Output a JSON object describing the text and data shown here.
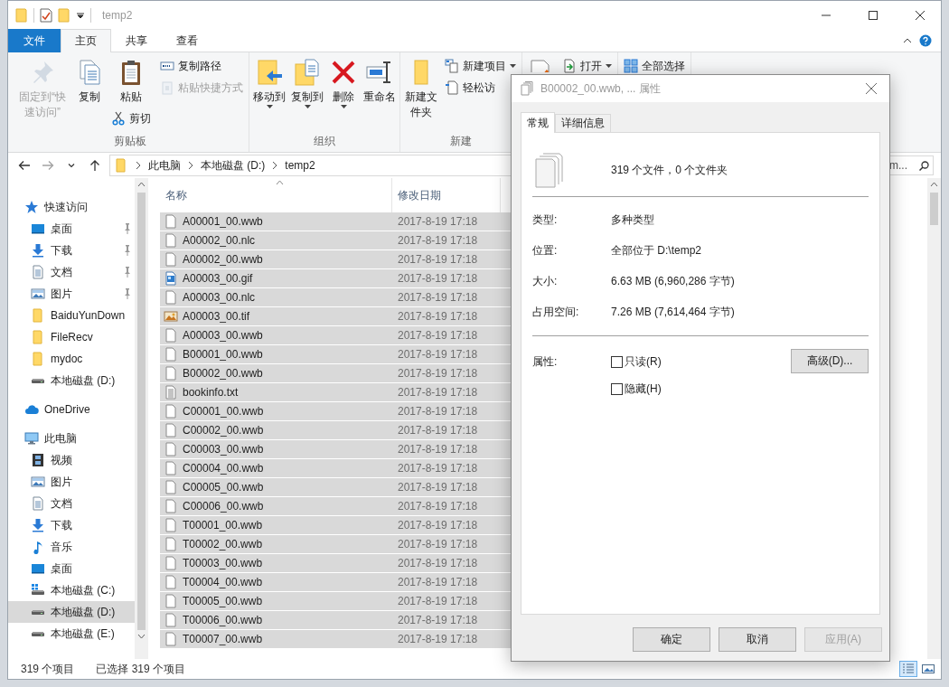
{
  "window": {
    "title": "temp2"
  },
  "ribbon": {
    "tabs": [
      {
        "label": "文件",
        "kind": "file_menu",
        "selected": false
      },
      {
        "label": "主页",
        "kind": "tab",
        "selected": true
      },
      {
        "label": "共享",
        "kind": "tab",
        "selected": false
      },
      {
        "label": "查看",
        "kind": "tab",
        "selected": false
      }
    ],
    "groups": [
      {
        "label": "剪贴板",
        "columns": [
          [
            {
              "kind": "pin",
              "label": "固定到“快速访问”",
              "disabled": true,
              "dropdown": false
            }
          ],
          [
            {
              "kind": "copy",
              "label": "复制",
              "disabled": false,
              "dropdown": false
            }
          ],
          [
            {
              "kind": "paste",
              "label": "粘贴",
              "disabled": false,
              "dropdown": false
            },
            {
              "kind": "cut",
              "label": "剪切",
              "disabled": false,
              "dropdown": false
            }
          ],
          [
            {
              "kind": "copy_path",
              "label": "复制路径",
              "disabled": false,
              "dropdown": false
            },
            {
              "kind": "paste_shortcut",
              "label": "粘贴快捷方式",
              "disabled": true,
              "dropdown": false
            }
          ]
        ]
      },
      {
        "label": "组织",
        "columns": [
          [
            {
              "kind": "move_to",
              "label": "移动到",
              "disabled": false,
              "dropdown": true
            }
          ],
          [
            {
              "kind": "copy_to",
              "label": "复制到",
              "disabled": false,
              "dropdown": true
            }
          ],
          [
            {
              "kind": "delete",
              "label": "删除",
              "disabled": false,
              "dropdown": true
            }
          ],
          [
            {
              "kind": "rename",
              "label": "重命名",
              "disabled": false,
              "dropdown": false
            }
          ]
        ]
      },
      {
        "label": "新建",
        "columns": [
          [
            {
              "kind": "new_folder",
              "label": "新建文件夹",
              "disabled": false,
              "dropdown": false
            }
          ],
          [
            {
              "kind": "new_item",
              "label": "新建项目",
              "disabled": false,
              "dropdown": true
            },
            {
              "kind": "easy_access",
              "label": "轻松访",
              "disabled": false,
              "dropdown": false
            }
          ]
        ]
      },
      {
        "columns": [
          [
            {
              "kind": "properties",
              "disabled": false,
              "dropdown": false
            }
          ],
          [
            {
              "kind": "open",
              "label": "打开",
              "disabled": false,
              "dropdown": true
            }
          ]
        ]
      },
      {
        "columns": [
          [
            {
              "kind": "select_all",
              "label": "全部选择",
              "disabled": false,
              "dropdown": false
            }
          ]
        ]
      }
    ]
  },
  "address": {
    "nav_buttons": [
      {
        "kind": "back",
        "disabled": false
      },
      {
        "kind": "forward",
        "disabled": true
      },
      {
        "kind": "recent",
        "disabled": false
      },
      {
        "kind": "up",
        "disabled": false
      }
    ],
    "segments": [
      "此电脑",
      "本地磁盘 (D:)",
      "temp2"
    ],
    "search": "m..."
  },
  "sidebar": {
    "items": [
      {
        "label": "快速访问",
        "kind": "quick_access",
        "selected": false,
        "children": [
          {
            "label": "桌面",
            "kind": "desktop",
            "pinned": true,
            "selected": false
          },
          {
            "label": "下载",
            "kind": "downloads",
            "pinned": true,
            "selected": false
          },
          {
            "label": "文档",
            "kind": "documents",
            "pinned": true,
            "selected": false
          },
          {
            "label": "图片",
            "kind": "pictures",
            "pinned": true,
            "selected": false
          },
          {
            "label": "BaiduYunDown",
            "kind": "folder",
            "pinned": false,
            "selected": false
          },
          {
            "label": "FileRecv",
            "kind": "folder",
            "pinned": false,
            "selected": false
          },
          {
            "label": "mydoc",
            "kind": "folder",
            "pinned": false,
            "selected": false
          },
          {
            "label": "本地磁盘 (D:)",
            "kind": "drive",
            "pinned": false,
            "selected": false
          }
        ]
      },
      {
        "label": "OneDrive",
        "kind": "onedrive",
        "selected": false
      },
      {
        "label": "此电脑",
        "kind": "this_pc",
        "selected": false,
        "children": [
          {
            "label": "视频",
            "kind": "videos",
            "pinned": false,
            "selected": false
          },
          {
            "label": "图片",
            "kind": "pictures",
            "pinned": false,
            "selected": false
          },
          {
            "label": "文档",
            "kind": "documents",
            "pinned": false,
            "selected": false
          },
          {
            "label": "下载",
            "kind": "downloads",
            "pinned": false,
            "selected": false
          },
          {
            "label": "音乐",
            "kind": "music",
            "pinned": false,
            "selected": false
          },
          {
            "label": "桌面",
            "kind": "desktop",
            "pinned": false,
            "selected": false
          },
          {
            "label": "本地磁盘 (C:)",
            "kind": "system_drive",
            "pinned": false,
            "selected": false
          },
          {
            "label": "本地磁盘 (D:)",
            "kind": "drive",
            "pinned": false,
            "selected": true
          },
          {
            "label": "本地磁盘 (E:)",
            "kind": "drive",
            "pinned": false,
            "selected": false
          }
        ]
      }
    ]
  },
  "file_list": {
    "columns": [
      {
        "label": "名称",
        "sorted": true
      },
      {
        "label": "修改日期",
        "sorted": false
      }
    ],
    "rows": [
      {
        "name": "A00001_00.wwb",
        "kind": "blank",
        "modified": "2017-8-19 17:18",
        "selected": true
      },
      {
        "name": "A00002_00.nlc",
        "kind": "blank",
        "modified": "2017-8-19 17:18",
        "selected": true
      },
      {
        "name": "A00002_00.wwb",
        "kind": "blank",
        "modified": "2017-8-19 17:18",
        "selected": true
      },
      {
        "name": "A00003_00.gif",
        "kind": "gif",
        "modified": "2017-8-19 17:18",
        "selected": true
      },
      {
        "name": "A00003_00.nlc",
        "kind": "blank",
        "modified": "2017-8-19 17:18",
        "selected": true
      },
      {
        "name": "A00003_00.tif",
        "kind": "tif",
        "modified": "2017-8-19 17:18",
        "selected": true
      },
      {
        "name": "A00003_00.wwb",
        "kind": "blank",
        "modified": "2017-8-19 17:18",
        "selected": true
      },
      {
        "name": "B00001_00.wwb",
        "kind": "blank",
        "modified": "2017-8-19 17:18",
        "selected": true
      },
      {
        "name": "B00002_00.wwb",
        "kind": "blank",
        "modified": "2017-8-19 17:18",
        "selected": true
      },
      {
        "name": "bookinfo.txt",
        "kind": "text",
        "modified": "2017-8-19 17:18",
        "selected": true
      },
      {
        "name": "C00001_00.wwb",
        "kind": "blank",
        "modified": "2017-8-19 17:18",
        "selected": true
      },
      {
        "name": "C00002_00.wwb",
        "kind": "blank",
        "modified": "2017-8-19 17:18",
        "selected": true
      },
      {
        "name": "C00003_00.wwb",
        "kind": "blank",
        "modified": "2017-8-19 17:18",
        "selected": true
      },
      {
        "name": "C00004_00.wwb",
        "kind": "blank",
        "modified": "2017-8-19 17:18",
        "selected": true
      },
      {
        "name": "C00005_00.wwb",
        "kind": "blank",
        "modified": "2017-8-19 17:18",
        "selected": true
      },
      {
        "name": "C00006_00.wwb",
        "kind": "blank",
        "modified": "2017-8-19 17:18",
        "selected": true
      },
      {
        "name": "T00001_00.wwb",
        "kind": "blank",
        "modified": "2017-8-19 17:18",
        "selected": true
      },
      {
        "name": "T00002_00.wwb",
        "kind": "blank",
        "modified": "2017-8-19 17:18",
        "selected": true
      },
      {
        "name": "T00003_00.wwb",
        "kind": "blank",
        "modified": "2017-8-19 17:18",
        "selected": true
      },
      {
        "name": "T00004_00.wwb",
        "kind": "blank",
        "modified": "2017-8-19 17:18",
        "selected": true
      },
      {
        "name": "T00005_00.wwb",
        "kind": "blank",
        "modified": "2017-8-19 17:18",
        "selected": true
      },
      {
        "name": "T00006_00.wwb",
        "kind": "blank",
        "modified": "2017-8-19 17:18",
        "selected": true
      },
      {
        "name": "T00007_00.wwb",
        "kind": "blank",
        "modified": "2017-8-19 17:18",
        "selected": true
      }
    ]
  },
  "status_bar": {
    "item_count": "319 个项目",
    "selection": "已选择 319 个项目",
    "views": [
      {
        "kind": "details",
        "selected": true
      },
      {
        "kind": "large_icons",
        "selected": false
      }
    ]
  },
  "properties_dialog": {
    "title": "B00002_00.wwb, ... 属性",
    "tabs": [
      {
        "label": "常规",
        "selected": true
      },
      {
        "label": "详细信息",
        "selected": false
      }
    ],
    "summary": "319 个文件，0 个文件夹",
    "details": [
      {
        "label": "类型:",
        "value": "多种类型"
      },
      {
        "label": "位置:",
        "value": "全部位于 D:\\temp2"
      },
      {
        "label": "大小:",
        "value": "6.63 MB (6,960,286 字节)"
      },
      {
        "label": "占用空间:",
        "value": "7.26 MB (7,614,464 字节)"
      }
    ],
    "attributes_label": "属性:",
    "attributes": [
      {
        "label": "只读(R)",
        "checked": false
      },
      {
        "label": "隐藏(H)",
        "checked": false
      }
    ],
    "advanced_button": "高级(D)...",
    "buttons": [
      {
        "label": "确定",
        "disabled": false
      },
      {
        "label": "取消",
        "disabled": false
      },
      {
        "label": "应用(A)",
        "disabled": true
      }
    ]
  }
}
